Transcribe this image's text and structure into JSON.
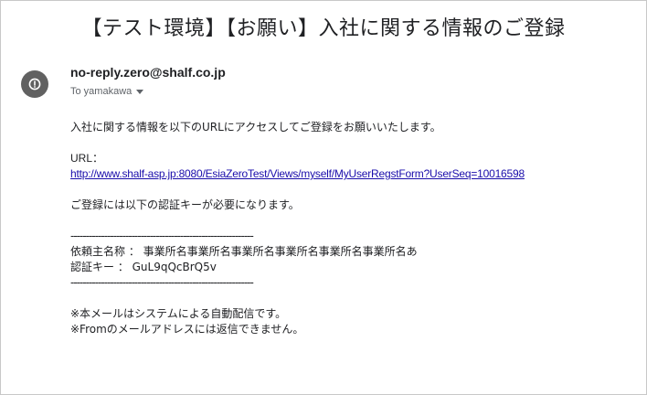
{
  "email": {
    "subject": "【テスト環境】【お願い】入社に関する情報のご登録",
    "sender": "no-reply.zero@shalf.co.jp",
    "to_label": "To yamakawa",
    "body": {
      "intro": "入社に関する情報を以下のURLにアクセスしてご登録をお願いいたします。",
      "url_label": "URL：",
      "url_link": "http://www.shalf-asp.jp:8080/EsiaZeroTest/Views/myself/MyUserRegstForm?UserSeq=10016598",
      "key_notice": "ご登録には以下の認証キーが必要になります。",
      "separator_top": "------------------------------------------------------------",
      "requester_line": "依頼主名称 ： 事業所名事業所名事業所名事業所名事業所名事業所名あ",
      "auth_key_line": "認証キー ： GuL9qQcBrQ5v",
      "separator_bottom": "------------------------------------------------------------",
      "footer_line1": "※本メールはシステムによる自動配信です。",
      "footer_line2": "※Fromのメールアドレスには返信できません。"
    }
  },
  "icons": {
    "avatar": "info-circle-icon",
    "to_dropdown": "caret-down-icon"
  },
  "colors": {
    "link": "#1a0dab",
    "avatar_bg": "#616161",
    "secondary_text": "#5f6368"
  }
}
